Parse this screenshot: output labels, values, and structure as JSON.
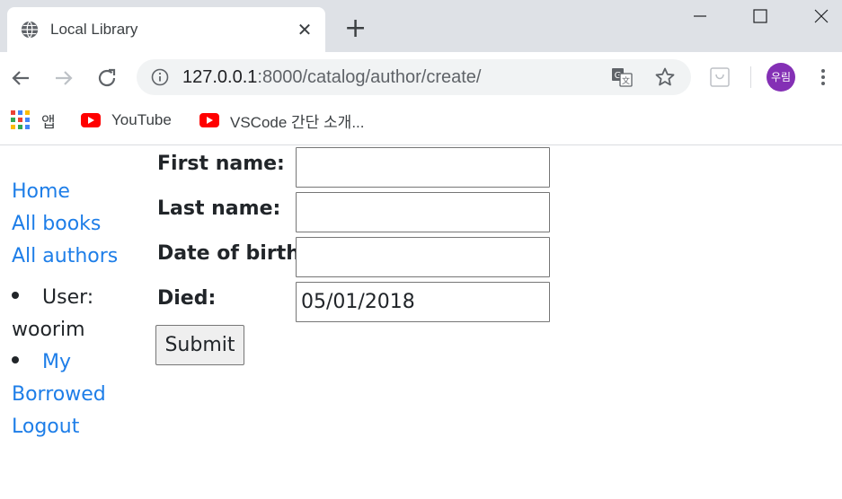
{
  "browser": {
    "tab_title": "Local Library",
    "url_host": "127.0.0.1",
    "url_rest": ":8000/catalog/author/create/",
    "avatar_text": "우림",
    "bookmarks": [
      {
        "label": "앱",
        "icon": "apps-grid-icon"
      },
      {
        "label": "YouTube",
        "icon": "youtube-icon"
      },
      {
        "label": "VSCode 간단 소개...",
        "icon": "youtube-icon"
      }
    ]
  },
  "sidebar": {
    "links": [
      "Home",
      "All books",
      "All authors"
    ],
    "user_prefix": "User:",
    "user_name": "woorim",
    "my_label": "My",
    "borrowed_label": "Borrowed",
    "logout_label": "Logout"
  },
  "form": {
    "first_name_label": "First name:",
    "last_name_label": "Last name:",
    "dob_label": "Date of birth:",
    "died_label": "Died:",
    "first_name_value": "",
    "last_name_value": "",
    "dob_value": "",
    "died_value": "05/01/2018",
    "submit_label": "Submit"
  },
  "colors": {
    "link": "#1e7ee8",
    "titlebar": "#dee1e6",
    "avatar": "#8430b5"
  }
}
